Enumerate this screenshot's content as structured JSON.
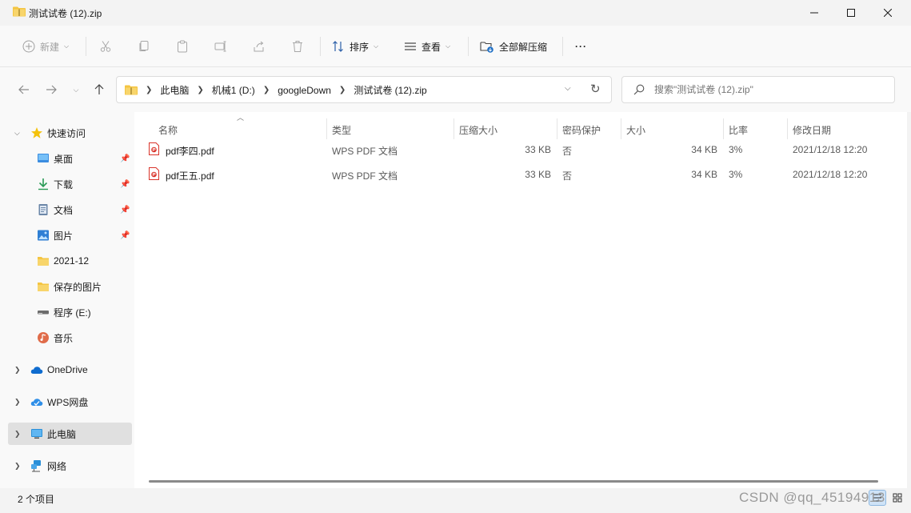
{
  "window": {
    "title": "测试试卷 (12).zip"
  },
  "toolbar": {
    "new_label": "新建",
    "sort_label": "排序",
    "view_label": "查看",
    "extract_all_label": "全部解压缩",
    "more_label": "···"
  },
  "address": {
    "crumbs": [
      "此电脑",
      "机械1 (D:)",
      "googleDown",
      "测试试卷 (12).zip"
    ]
  },
  "search": {
    "placeholder": "搜索\"测试试卷 (12).zip\""
  },
  "sidebar": {
    "quick_access": "快速访问",
    "items": [
      {
        "label": "桌面",
        "icon": "desktop-icon",
        "pinned": true
      },
      {
        "label": "下载",
        "icon": "download-icon",
        "pinned": true
      },
      {
        "label": "文档",
        "icon": "document-icon",
        "pinned": true
      },
      {
        "label": "图片",
        "icon": "picture-icon",
        "pinned": true
      },
      {
        "label": "2021-12",
        "icon": "folder-icon",
        "pinned": false
      },
      {
        "label": "保存的图片",
        "icon": "folder-icon",
        "pinned": false
      },
      {
        "label": "程序 (E:)",
        "icon": "drive-icon",
        "pinned": false
      },
      {
        "label": "音乐",
        "icon": "music-icon",
        "pinned": false
      }
    ],
    "onedrive": "OneDrive",
    "wps": "WPS网盘",
    "this_pc": "此电脑",
    "network": "网络"
  },
  "columns": {
    "name": "名称",
    "type": "类型",
    "compressed_size": "压缩大小",
    "password": "密码保护",
    "size": "大小",
    "ratio": "比率",
    "modified": "修改日期"
  },
  "files": [
    {
      "name": "pdf李四.pdf",
      "type": "WPS PDF 文档",
      "compressed_size": "33 KB",
      "password": "否",
      "size": "34 KB",
      "ratio": "3%",
      "modified": "2021/12/18 12:20"
    },
    {
      "name": "pdf王五.pdf",
      "type": "WPS PDF 文档",
      "compressed_size": "33 KB",
      "password": "否",
      "size": "34 KB",
      "ratio": "3%",
      "modified": "2021/12/18 12:20"
    }
  ],
  "status": {
    "item_count": "2 个项目"
  },
  "watermark": "CSDN @qq_45194913",
  "colors": {
    "accent": "#0067c0",
    "selected_bg": "#e0e0e0",
    "pdf_red": "#d9342b",
    "folder_yellow": "#f4c542"
  }
}
